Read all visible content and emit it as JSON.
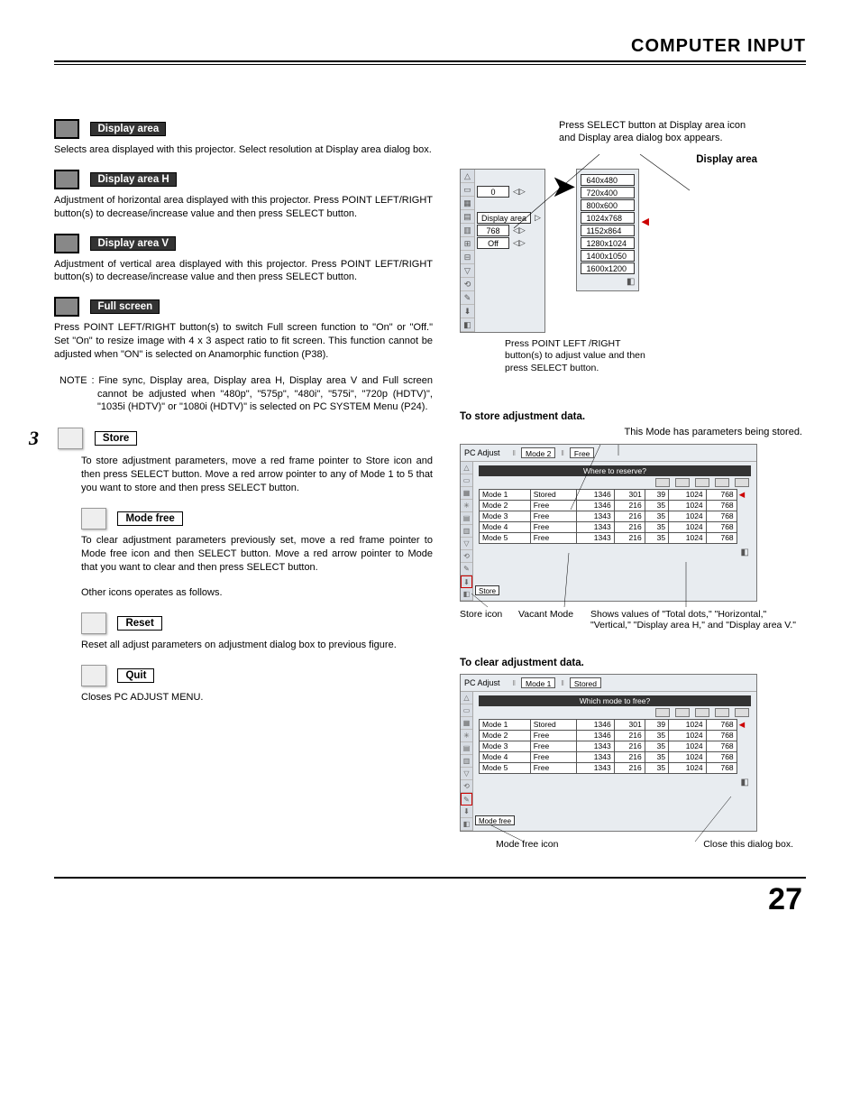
{
  "header": {
    "title": "COMPUTER INPUT"
  },
  "page_number": "27",
  "left": {
    "display_area": {
      "label": "Display area",
      "text": "Selects area displayed with this projector. Select resolution at Display area dialog box."
    },
    "display_area_h": {
      "label": "Display area H",
      "text": "Adjustment of horizontal area displayed with this projector.  Press POINT LEFT/RIGHT button(s) to decrease/increase value and then press SELECT button."
    },
    "display_area_v": {
      "label": "Display area V",
      "text": "Adjustment of vertical area displayed with this projector.  Press POINT LEFT/RIGHT button(s) to decrease/increase value and then press SELECT button."
    },
    "full_screen": {
      "label": "Full screen",
      "text": "Press POINT LEFT/RIGHT button(s) to switch Full screen function to \"On\" or \"Off.\"  Set \"On\" to resize image with 4 x 3 aspect ratio to fit screen. This function cannot be adjusted when \"ON\" is selected on Anamorphic function (P38)."
    },
    "note": "NOTE : Fine sync, Display area, Display area H, Display area V and Full screen cannot be adjusted when \"480p\", \"575p\", \"480i\", \"575i\", \"720p (HDTV)\", \"1035i (HDTV)\" or \"1080i (HDTV)\" is selected on PC SYSTEM Menu (P24).",
    "step3": "3",
    "store": {
      "label": "Store",
      "text": "To store adjustment parameters, move a red frame pointer to Store icon and then press SELECT button.  Move a red arrow pointer to any of Mode 1 to 5 that you want to store and then press SELECT button."
    },
    "mode_free": {
      "label": "Mode free",
      "text": "To clear adjustment parameters previously set, move a red frame pointer to Mode free icon and then SELECT button.  Move a red arrow pointer to Mode that you want to clear and then press SELECT button."
    },
    "other_icons": "Other icons operates as follows.",
    "reset": {
      "label": "Reset",
      "text": "Reset all adjust parameters on adjustment dialog box to previous figure."
    },
    "quit": {
      "label": "Quit",
      "text": "Closes PC ADJUST MENU."
    }
  },
  "right": {
    "top_caption": "Press SELECT button at Display area icon and Display area dialog box appears.",
    "display_area_title": "Display area",
    "ui_values": {
      "zero": "0",
      "display_area": "Display area",
      "val768": "768",
      "off": "Off"
    },
    "resolutions": [
      "640x480",
      "720x400",
      "800x600",
      "1024x768",
      "1152x864",
      "1280x1024",
      "1400x1050",
      "1600x1200"
    ],
    "mid_caption": "Press POINT LEFT /RIGHT button(s) to adjust value and then press SELECT button.",
    "store_section": {
      "title": "To store adjustment data.",
      "subtitle": "This Mode has parameters being stored.",
      "pc_adjust": "PC Adjust",
      "header_mode": "Mode 2",
      "header_status": "Free",
      "banner": "Where to reserve?",
      "rows": [
        {
          "mode": "Mode 1",
          "status": "Stored",
          "c1": "1346",
          "c2": "301",
          "c3": "39",
          "c4": "1024",
          "c5": "768"
        },
        {
          "mode": "Mode 2",
          "status": "Free",
          "c1": "1346",
          "c2": "216",
          "c3": "35",
          "c4": "1024",
          "c5": "768"
        },
        {
          "mode": "Mode 3",
          "status": "Free",
          "c1": "1343",
          "c2": "216",
          "c3": "35",
          "c4": "1024",
          "c5": "768"
        },
        {
          "mode": "Mode 4",
          "status": "Free",
          "c1": "1343",
          "c2": "216",
          "c3": "35",
          "c4": "1024",
          "c5": "768"
        },
        {
          "mode": "Mode 5",
          "status": "Free",
          "c1": "1343",
          "c2": "216",
          "c3": "35",
          "c4": "1024",
          "c5": "768"
        }
      ],
      "tag": "Store",
      "callout_left": "Store icon",
      "callout_mid": "Vacant Mode",
      "callout_right": "Shows values of \"Total dots,\" \"Horizontal,\" \"Vertical,\" \"Display area H,\" and \"Display area V.\""
    },
    "clear_section": {
      "title": "To clear adjustment data.",
      "pc_adjust": "PC Adjust",
      "header_mode": "Mode 1",
      "header_status": "Stored",
      "banner": "Which mode to free?",
      "rows": [
        {
          "mode": "Mode 1",
          "status": "Stored",
          "c1": "1346",
          "c2": "301",
          "c3": "39",
          "c4": "1024",
          "c5": "768"
        },
        {
          "mode": "Mode 2",
          "status": "Free",
          "c1": "1346",
          "c2": "216",
          "c3": "35",
          "c4": "1024",
          "c5": "768"
        },
        {
          "mode": "Mode 3",
          "status": "Free",
          "c1": "1343",
          "c2": "216",
          "c3": "35",
          "c4": "1024",
          "c5": "768"
        },
        {
          "mode": "Mode 4",
          "status": "Free",
          "c1": "1343",
          "c2": "216",
          "c3": "35",
          "c4": "1024",
          "c5": "768"
        },
        {
          "mode": "Mode 5",
          "status": "Free",
          "c1": "1343",
          "c2": "216",
          "c3": "35",
          "c4": "1024",
          "c5": "768"
        }
      ],
      "tag": "Mode free",
      "callout_left": "Mode free icon",
      "callout_right": "Close this dialog box."
    }
  }
}
